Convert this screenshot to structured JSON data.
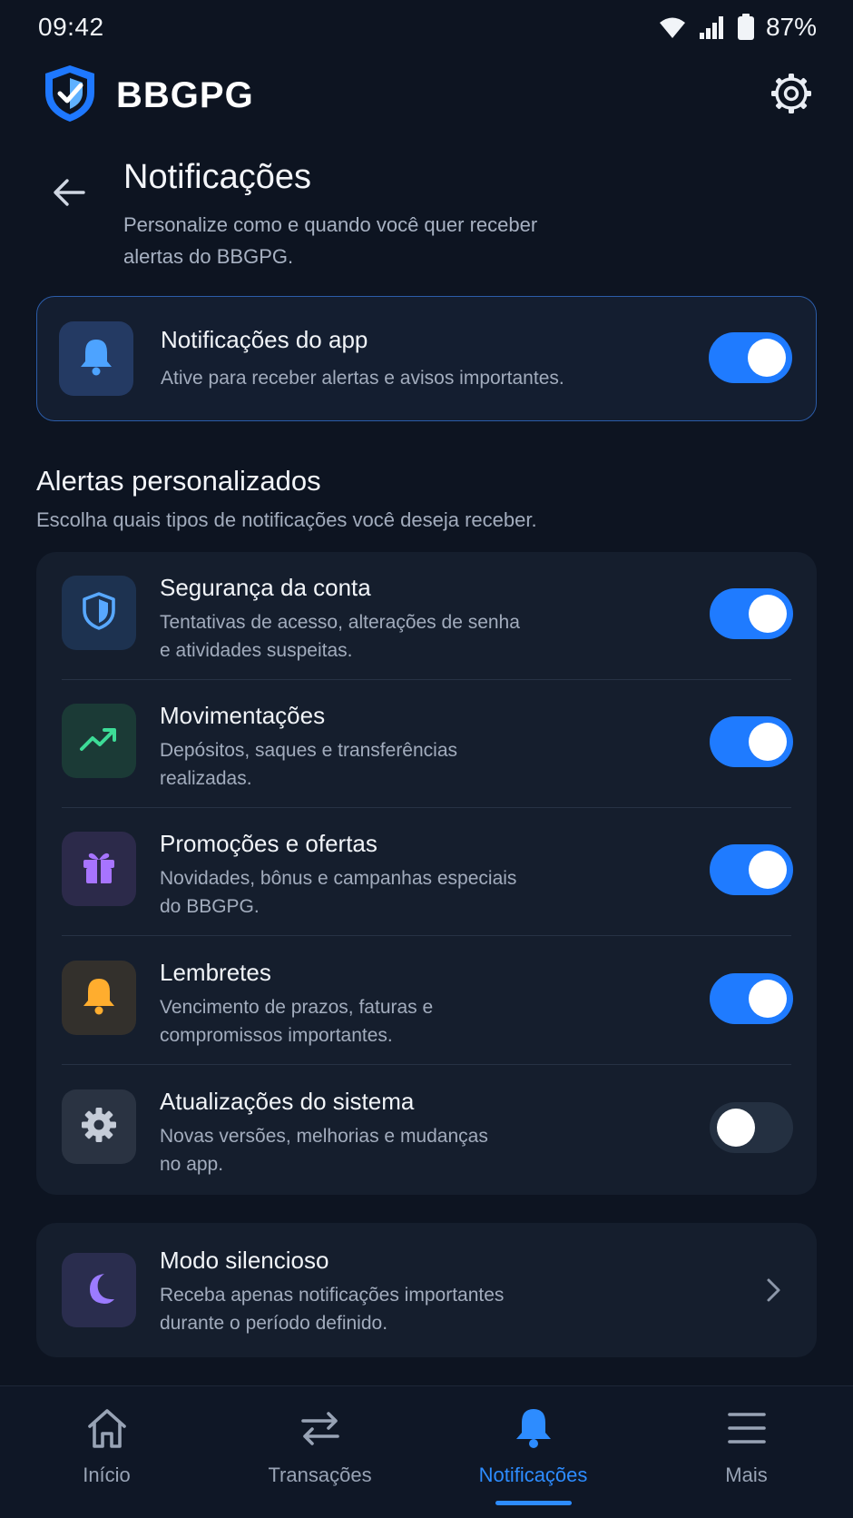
{
  "status_bar": {
    "time": "09:42",
    "battery": "87%"
  },
  "header": {
    "brand": "BBGPG"
  },
  "page": {
    "title": "Notificações",
    "subtitle_line1": "Personalize como e quando você quer receber",
    "subtitle_line2": "alertas do BBGPG."
  },
  "master": {
    "title": "Notificações do app",
    "desc": "Ative para receber alertas e avisos importantes.",
    "enabled": true
  },
  "section": {
    "title": "Alertas personalizados",
    "desc": "Escolha quais tipos de notificações você deseja receber."
  },
  "alerts": [
    {
      "title": "Segurança da conta",
      "desc_line1": "Tentativas de acesso, alterações de senha",
      "desc_line2": "e atividades suspeitas.",
      "icon": "shield-icon",
      "enabled": true
    },
    {
      "title": "Movimentações",
      "desc_line1": "Depósitos, saques e transferências",
      "desc_line2": "realizadas.",
      "icon": "trending-up-icon",
      "enabled": true
    },
    {
      "title": "Promoções e ofertas",
      "desc_line1": "Novidades, bônus e campanhas especiais",
      "desc_line2": "do BBGPG.",
      "icon": "gift-icon",
      "enabled": true
    },
    {
      "title": "Lembretes",
      "desc_line1": "Vencimento de prazos, faturas e",
      "desc_line2": "compromissos importantes.",
      "icon": "bell-icon",
      "enabled": true
    },
    {
      "title": "Atualizações do sistema",
      "desc_line1": "Novas versões, melhorias e mudanças",
      "desc_line2": "no app.",
      "icon": "gear-icon",
      "enabled": false
    }
  ],
  "quiet": {
    "title": "Modo silencioso",
    "desc_line1": "Receba apenas notificações importantes",
    "desc_line2": "durante o período definido."
  },
  "nav": [
    {
      "label": "Início",
      "icon": "home-icon",
      "active": false
    },
    {
      "label": "Transações",
      "icon": "transfer-icon",
      "active": false
    },
    {
      "label": "Notificações",
      "icon": "bell-icon",
      "active": true
    },
    {
      "label": "Mais",
      "icon": "menu-icon",
      "active": false
    }
  ],
  "colors": {
    "accent": "#1f7bff",
    "background": "#0d1421",
    "card": "#151e2d"
  }
}
